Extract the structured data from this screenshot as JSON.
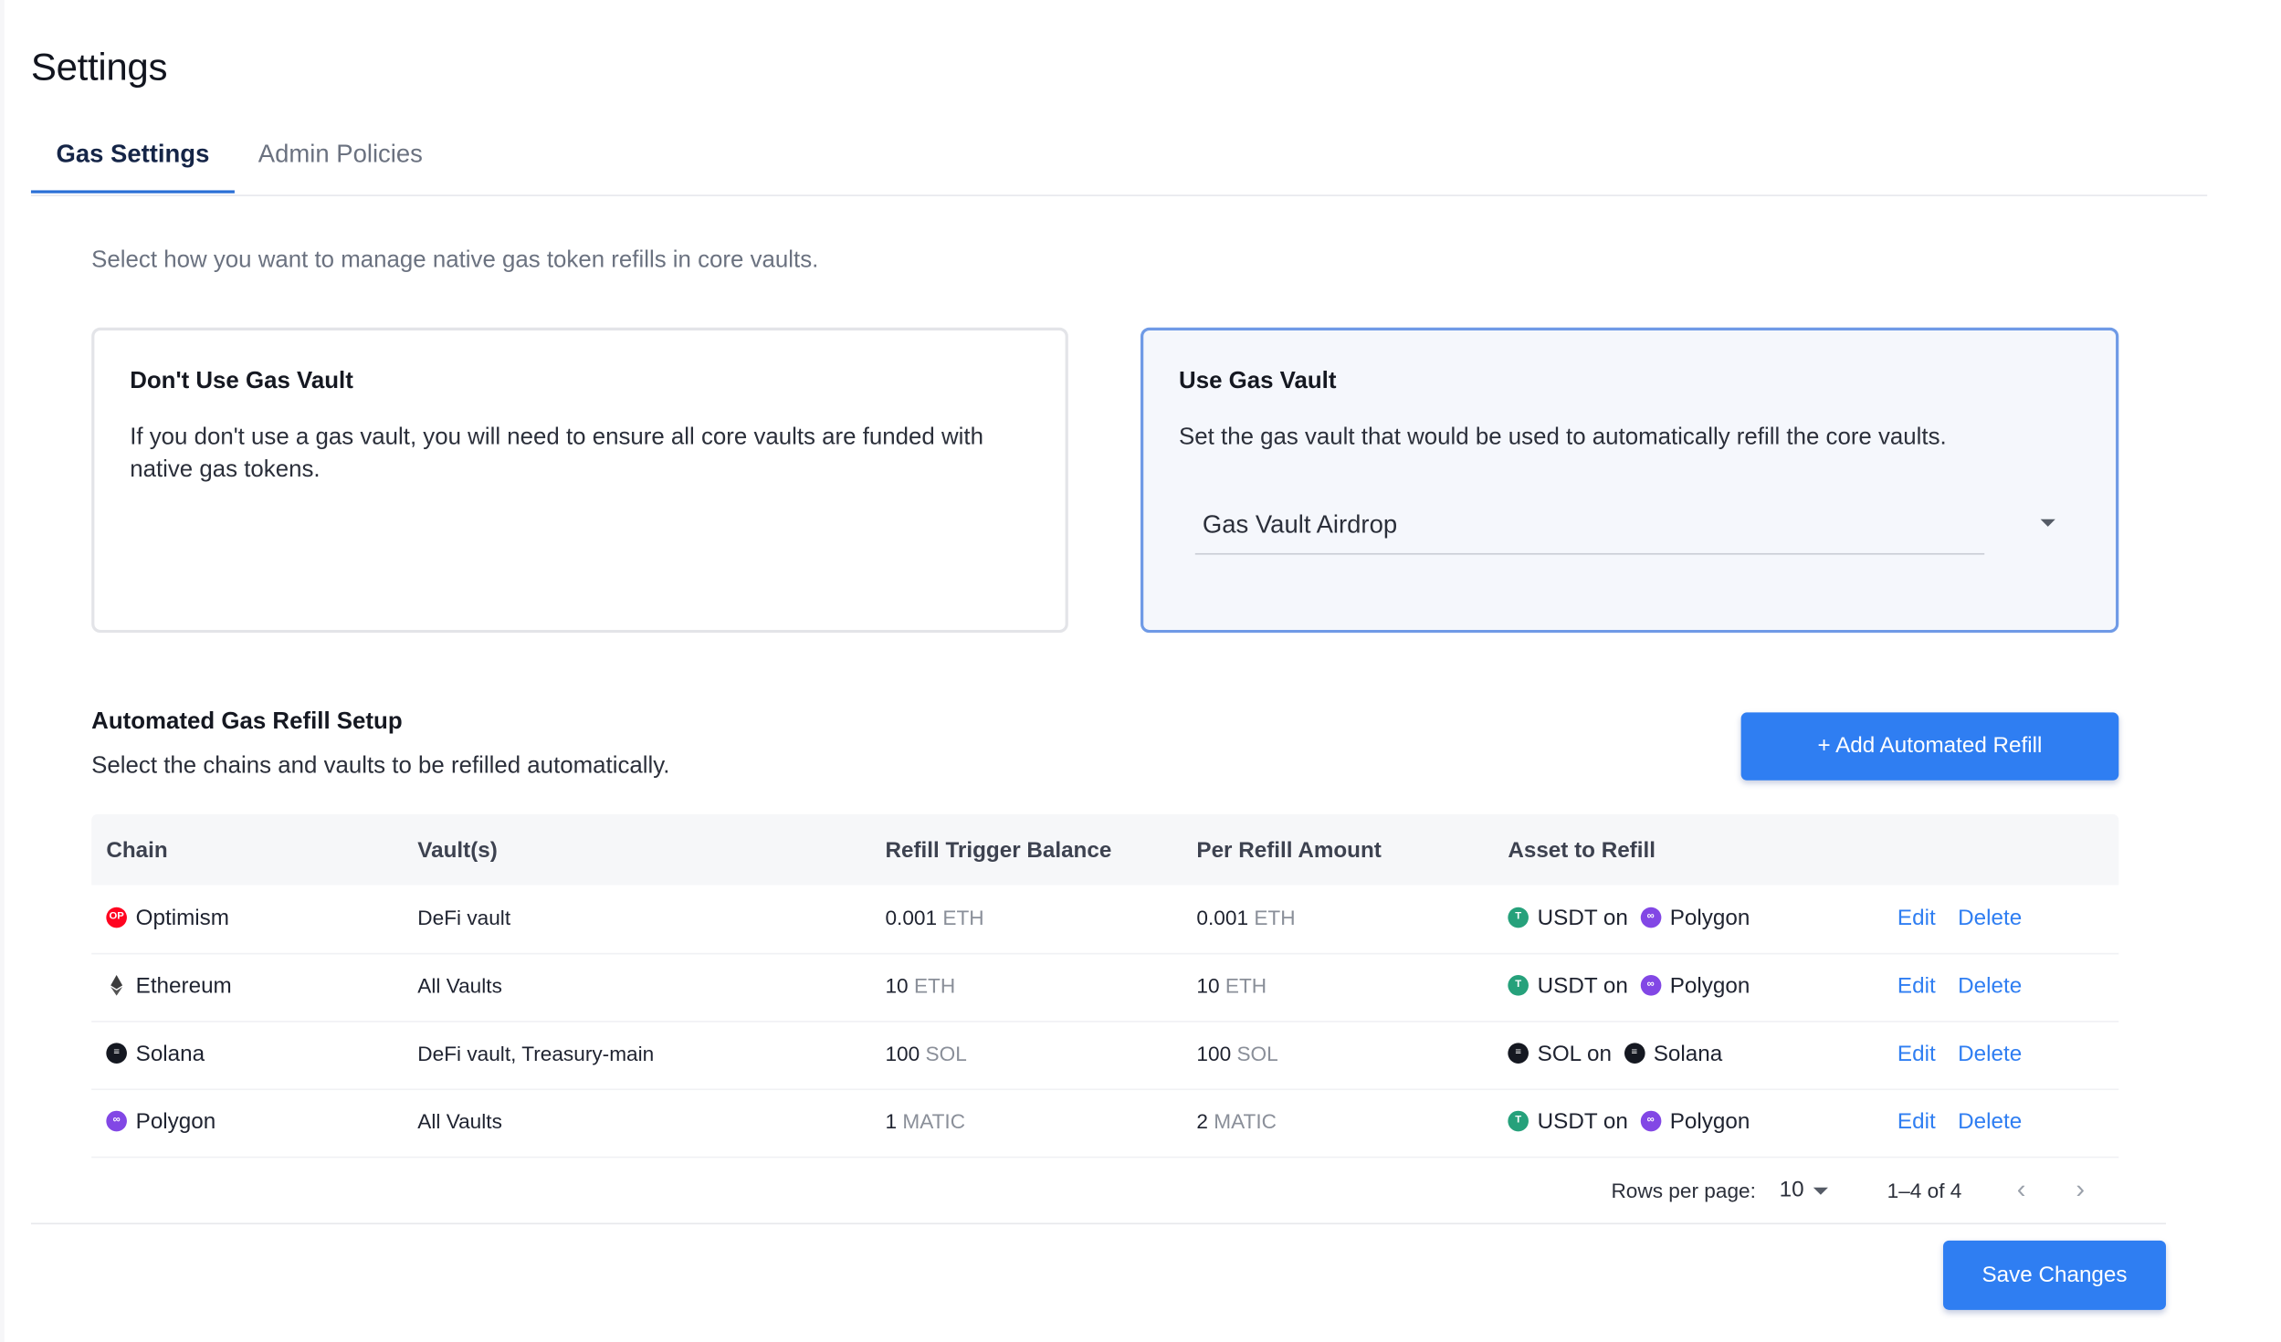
{
  "page": {
    "title": "Settings"
  },
  "tabs": [
    {
      "label": "Gas Settings",
      "active": true
    },
    {
      "label": "Admin Policies",
      "active": false
    }
  ],
  "intro": "Select how you want to manage native gas token refills in core vaults.",
  "options": {
    "no_vault": {
      "title": "Don't Use Gas Vault",
      "description": "If you don't use a gas vault, you will need to ensure all core vaults are funded with native gas tokens."
    },
    "use_vault": {
      "title": "Use Gas Vault",
      "description": "Set the gas vault that would be used to automatically refill the core vaults.",
      "selected_vault": "Gas Vault Airdrop",
      "selected": true
    }
  },
  "refill": {
    "title": "Automated Gas Refill Setup",
    "description": "Select the chains and vaults to be refilled automatically.",
    "add_button": "+ Add Automated Refill",
    "columns": [
      "Chain",
      "Vault(s)",
      "Refill Trigger Balance",
      "Per Refill Amount",
      "Asset to Refill"
    ],
    "rows": [
      {
        "chain": "Optimism",
        "chain_icon": "optimism-icon",
        "vaults": "DeFi vault",
        "trigger": "0.001",
        "trigger_unit": "ETH",
        "amount": "0.001",
        "amount_unit": "ETH",
        "asset": "USDT on",
        "asset_icon": "tether-icon",
        "asset_chain": "Polygon",
        "asset_chain_icon": "polygon-icon",
        "edit": "Edit",
        "delete": "Delete"
      },
      {
        "chain": "Ethereum",
        "chain_icon": "ethereum-icon",
        "vaults": "All Vaults",
        "trigger": "10",
        "trigger_unit": "ETH",
        "amount": "10",
        "amount_unit": "ETH",
        "asset": "USDT on",
        "asset_icon": "tether-icon",
        "asset_chain": "Polygon",
        "asset_chain_icon": "polygon-icon",
        "edit": "Edit",
        "delete": "Delete"
      },
      {
        "chain": "Solana",
        "chain_icon": "solana-icon",
        "vaults": "DeFi vault, Treasury-main",
        "trigger": "100",
        "trigger_unit": "SOL",
        "amount": "100",
        "amount_unit": "SOL",
        "asset": "SOL on",
        "asset_icon": "solana-icon",
        "asset_chain": "Solana",
        "asset_chain_icon": "solana-icon",
        "edit": "Edit",
        "delete": "Delete"
      },
      {
        "chain": "Polygon",
        "chain_icon": "polygon-icon",
        "vaults": "All Vaults",
        "trigger": "1",
        "trigger_unit": "MATIC",
        "amount": "2",
        "amount_unit": "MATIC",
        "asset": "USDT on",
        "asset_icon": "tether-icon",
        "asset_chain": "Polygon",
        "asset_chain_icon": "polygon-icon",
        "edit": "Edit",
        "delete": "Delete"
      }
    ],
    "pagination": {
      "rows_per_page_label": "Rows per page:",
      "rows_per_page": "10",
      "range": "1–4 of 4",
      "prev": "‹",
      "next": "›"
    }
  },
  "actions": {
    "save": "Save Changes"
  },
  "colors": {
    "accent": "#2f7ef2",
    "selected_border": "#6f9ae6",
    "optimism": "#ff0420",
    "polygon": "#8247e5",
    "tether": "#26a17b",
    "solana": "#151821"
  }
}
